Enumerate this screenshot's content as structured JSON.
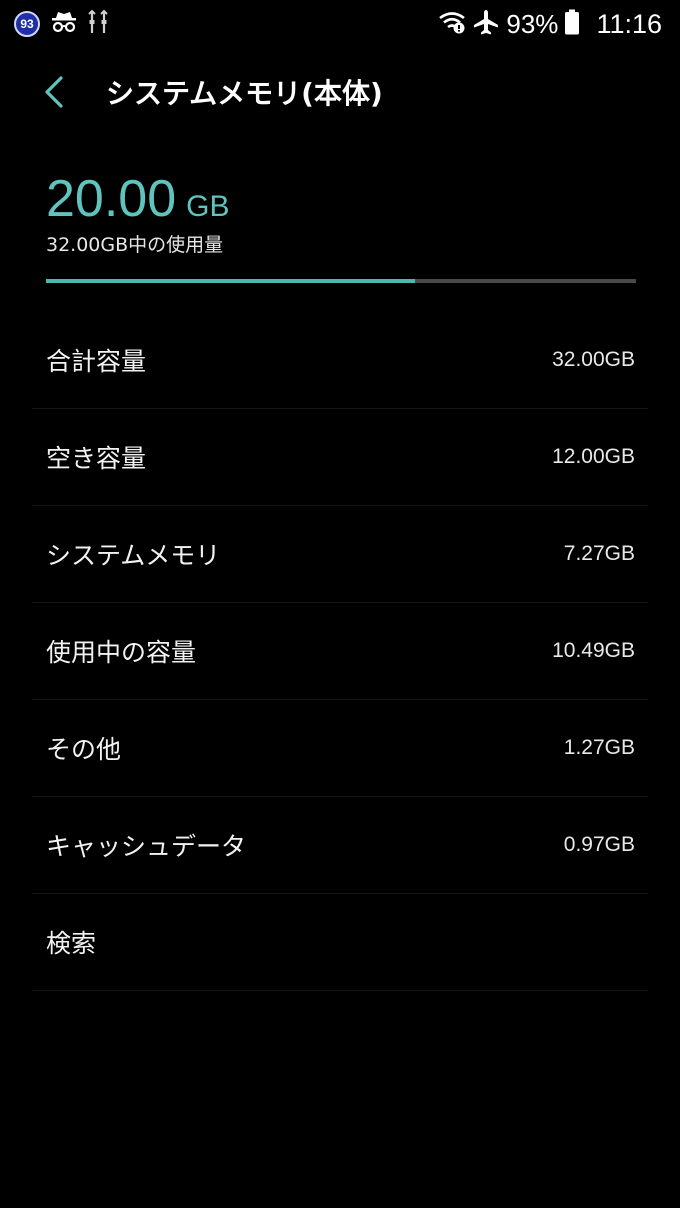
{
  "status_bar": {
    "notification_count": "93",
    "battery_percent": "93%",
    "time": "11:16",
    "icons": [
      "notification-count-badge",
      "incognito-icon",
      "usb-debug-icon",
      "wifi-icon",
      "airplane-mode-icon",
      "battery-icon"
    ]
  },
  "header": {
    "title": "システムメモリ(本体)",
    "back_icon": "chevron-left-icon"
  },
  "summary": {
    "used_value": "20.00",
    "used_unit": "GB",
    "caption": "32.00GB中の使用量",
    "usage_fraction": 0.625
  },
  "storage_items": [
    {
      "label": "合計容量",
      "value": "32.00GB"
    },
    {
      "label": "空き容量",
      "value": "12.00GB"
    },
    {
      "label": "システムメモリ",
      "value": "7.27GB"
    },
    {
      "label": "使用中の容量",
      "value": "10.49GB"
    },
    {
      "label": "その他",
      "value": "1.27GB"
    },
    {
      "label": "キャッシュデータ",
      "value": "0.97GB"
    },
    {
      "label": "検索",
      "value": ""
    }
  ],
  "colors": {
    "accent": "#5fc4bd",
    "bar_fill": "#4fb6b0",
    "bar_track": "#4a4a4a",
    "background": "#000000"
  }
}
